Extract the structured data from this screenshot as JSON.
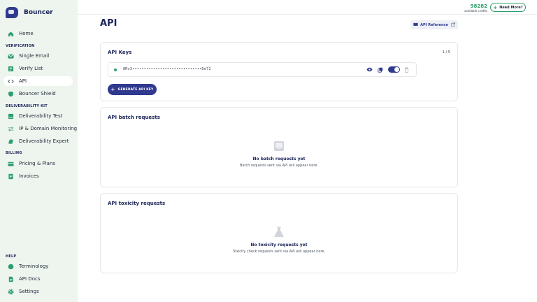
{
  "app": {
    "brand": "Bouncer"
  },
  "sidebar": {
    "home": "Home",
    "sections": {
      "verification": "VERIFICATION",
      "deliverability_kit": "DELIVERABILITY KIT",
      "billing": "BILLING",
      "help": "HELP"
    },
    "items": [
      {
        "label": "Single Email",
        "icon": "envelope-icon"
      },
      {
        "label": "Verify List",
        "icon": "list-icon"
      },
      {
        "label": "API",
        "icon": "code-icon",
        "active": true
      },
      {
        "label": "Bouncer Shield",
        "icon": "shield-icon"
      },
      {
        "label": "Deliverability Test",
        "icon": "inbox-icon"
      },
      {
        "label": "IP & Domain Monitoring",
        "icon": "arrows-icon"
      },
      {
        "label": "Deliverability Expert",
        "icon": "expert-icon"
      },
      {
        "label": "Pricing & Plans",
        "icon": "card-icon"
      },
      {
        "label": "Invoices",
        "icon": "invoice-icon"
      },
      {
        "label": "Terminology",
        "icon": "book-icon"
      },
      {
        "label": "API Docs",
        "icon": "docs-icon"
      },
      {
        "label": "Settings",
        "icon": "gear-icon"
      }
    ]
  },
  "topbar": {
    "credits": "98282",
    "credits_label": "available credits",
    "need_more": "Need More?"
  },
  "page": {
    "title": "API",
    "api_reference": "API Reference"
  },
  "api_keys": {
    "title": "API Keys",
    "count": "1 / 5",
    "key_masked": "8Mx3••••••••••••••••••••••••••••••De72",
    "generate_label": "GENERATE API KEY",
    "enabled": true
  },
  "batch": {
    "title": "API batch requests",
    "empty_title": "No batch requests yet",
    "empty_sub": "Batch requests sent via API will appear here."
  },
  "toxicity": {
    "title": "API toxicity requests",
    "empty_title": "No toxicity requests yet",
    "empty_sub": "Toxicity check requests sent via API will appear here."
  },
  "colors": {
    "brand": "#2f3a8f",
    "accent": "#2f9e6e",
    "sidebar_bg": "#eef5ef",
    "heading": "#1b2559"
  }
}
